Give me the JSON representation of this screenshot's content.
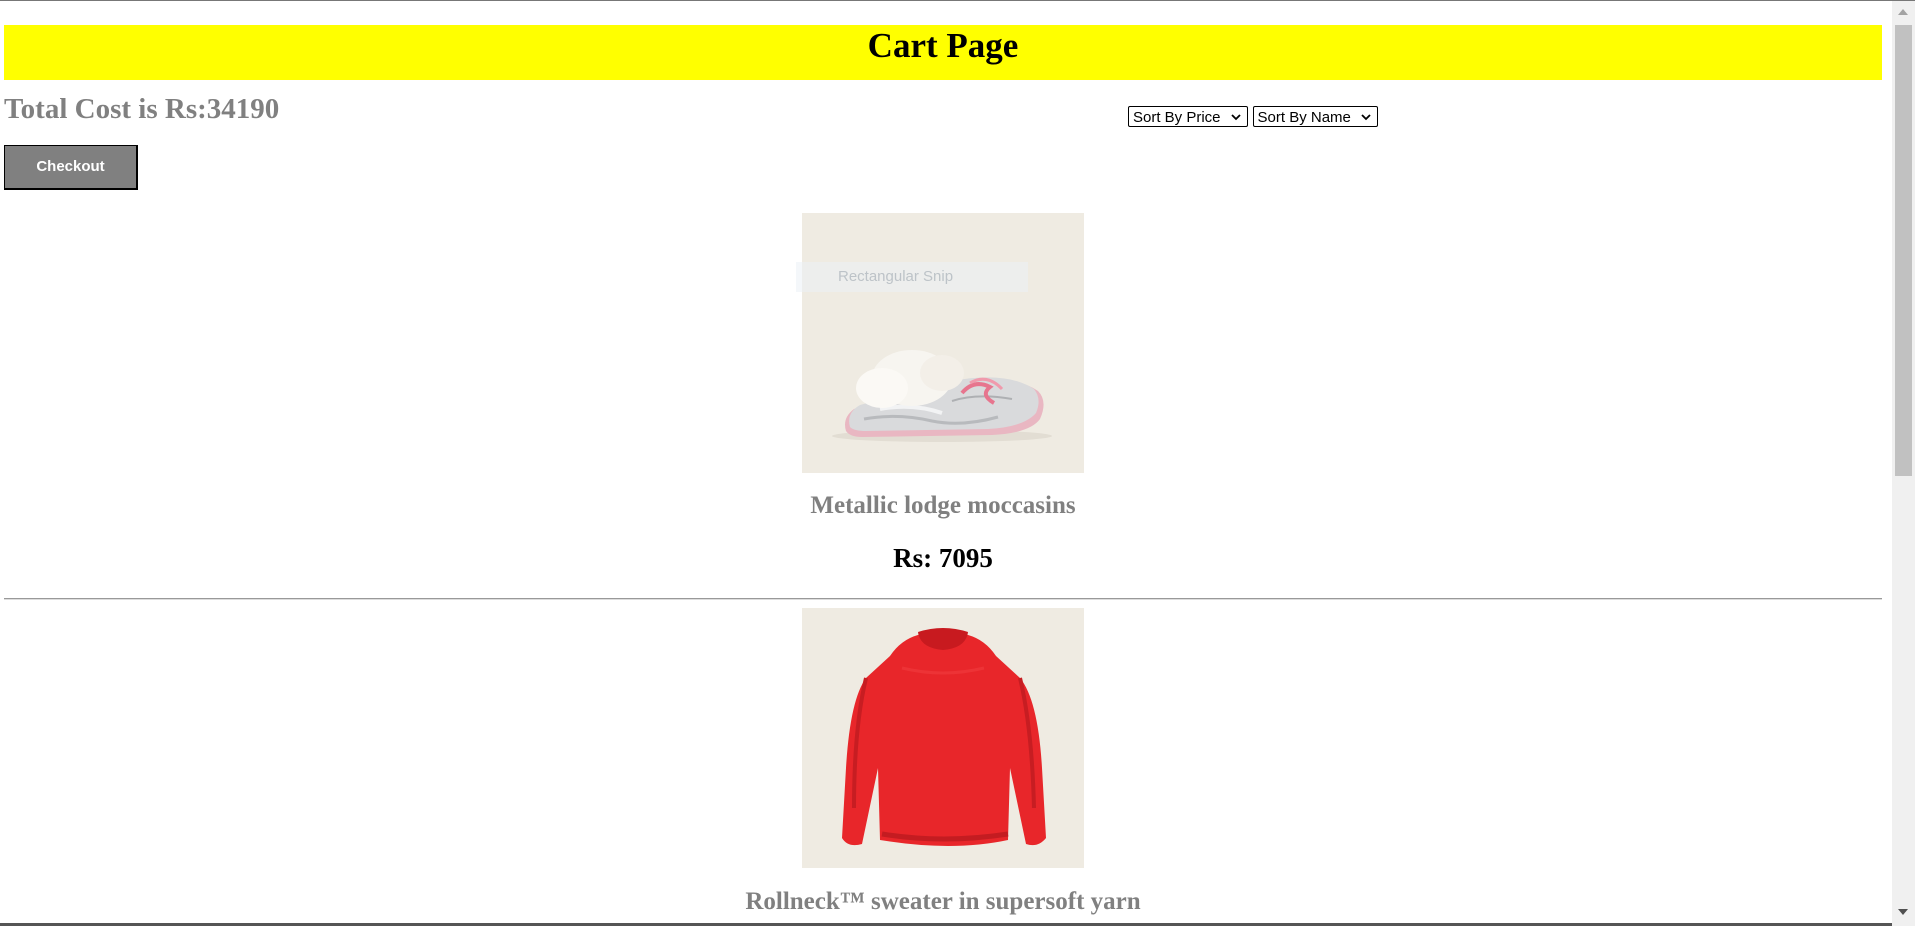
{
  "header": {
    "title": "Cart Page"
  },
  "summary": {
    "total_label": "Total Cost is Rs:34190"
  },
  "controls": {
    "sort_price": "Sort By Price",
    "sort_name": "Sort By Name",
    "checkout_label": "Checkout"
  },
  "overlay": {
    "snip_text": "Rectangular Snip"
  },
  "products": [
    {
      "name": "Metallic lodge moccasins",
      "price": "Rs: 7095",
      "image": "moccasin-shoe-image"
    },
    {
      "name": "Rollneck™ sweater in supersoft yarn",
      "image": "red-sweater-image"
    }
  ],
  "colors": {
    "banner": "#ffff00",
    "muted_text": "#808080",
    "button_bg": "#808080"
  }
}
